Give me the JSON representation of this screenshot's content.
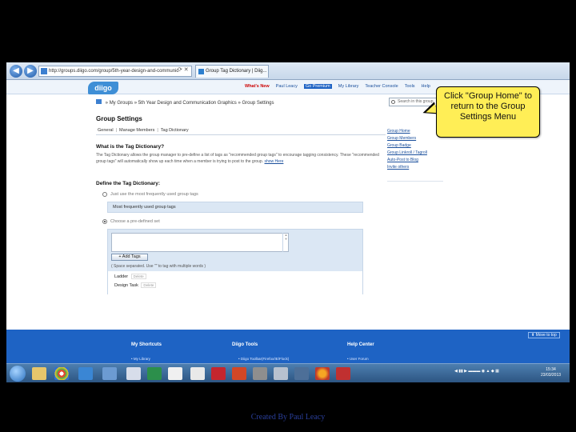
{
  "browser": {
    "url": "http://groups.diigo.com/group/5th-year-design-and-communic",
    "tab_title": "Group Tag Dictionary | Diig..."
  },
  "site": {
    "logo": "diigo",
    "nav": {
      "whats_new": "What's New",
      "user": "Paul Leacy",
      "premium": "Go Premium",
      "library": "My Library",
      "teacher_console": "Teacher Console",
      "tools": "Tools",
      "help": "Help"
    },
    "search_placeholder": "Search in this group"
  },
  "breadcrumb": {
    "my_groups": "My Groups",
    "group": "5th Year Design and Communication Graphics",
    "current": "Group Settings"
  },
  "main": {
    "title": "Group Settings",
    "subtabs": [
      "General",
      "Manage Members",
      "Tag Dictionary"
    ],
    "section1": {
      "title": "What is the Tag Dictionary?",
      "text": "The Tag Dictionary allows the group manager to pre-define a list of tags as \"recommended group tags\" to encourage tagging consistency. These \"recommended group tags\" will automatically show up each time when a member is trying to post to the group.",
      "link": "show Here"
    },
    "section2": {
      "title": "Define the Tag Dictionary:",
      "option1": "Just use the most frequently used group tags",
      "freq_box": "Most frequently used group tags",
      "option2": "Choose a pre-defined set",
      "add_tags": "+ Add Tags",
      "hint": "( Space separated. Use \"\" to tag with multiple words )",
      "rows": [
        {
          "tag": "Ladder",
          "action": "Delete"
        },
        {
          "tag": "Design Task",
          "action": "Delete"
        }
      ]
    }
  },
  "sidebar": {
    "links": [
      "Group Home",
      "Group Members",
      "Group Badge",
      "Group Linkroll / Tagroll",
      "Auto-Post to Blog",
      "Invite others"
    ]
  },
  "callout": {
    "text": "Click \"Group Home\" to return to the Group Settings Menu"
  },
  "footer": {
    "move_top": "Move to top",
    "headings": [
      "My Shortcuts",
      "Diigo Tools",
      "Help Center"
    ],
    "links": [
      "My Library",
      "Diigo Toolbar(Firefox/IE/Flock)",
      "User Forum"
    ]
  },
  "taskbar": {
    "clock_time": "15:34",
    "clock_date": "23/03/2013"
  },
  "credit": "Created By Paul Leacy"
}
